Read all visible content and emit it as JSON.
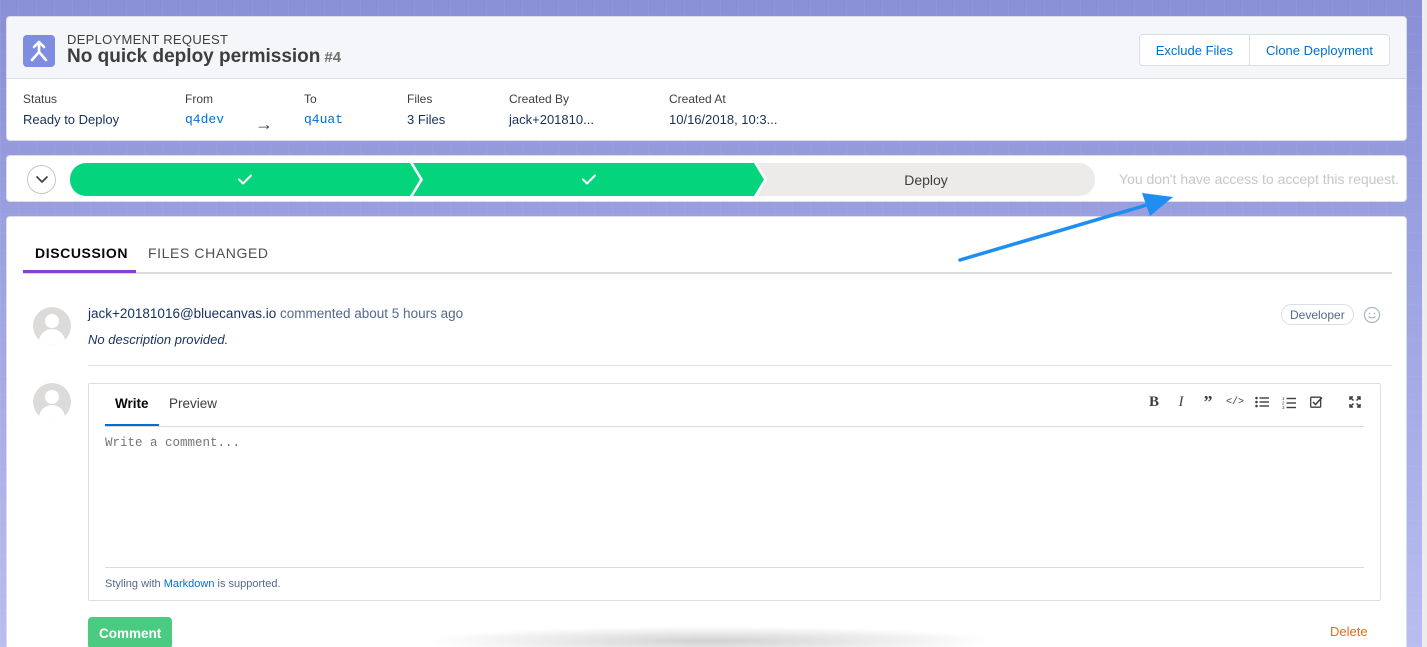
{
  "header": {
    "eyebrow": "DEPLOYMENT REQUEST",
    "title": "No quick deploy permission",
    "number": "#4",
    "icon": "merge-arrow-icon",
    "actions": {
      "exclude_files": "Exclude Files",
      "clone_deployment": "Clone Deployment"
    },
    "fields": {
      "status_label": "Status",
      "status_value": "Ready to Deploy",
      "from_label": "From",
      "from_value": "q4dev",
      "to_label": "To",
      "to_value": "q4uat",
      "files_label": "Files",
      "files_value": "3 Files",
      "created_by_label": "Created By",
      "created_by_value": "jack+201810...",
      "created_at_label": "Created At",
      "created_at_value": "10/16/2018, 10:3..."
    }
  },
  "path": {
    "stages": [
      {
        "status": "complete",
        "icon": "check-icon"
      },
      {
        "status": "complete",
        "icon": "check-icon"
      },
      {
        "status": "current",
        "label": "Deploy"
      }
    ],
    "message": "You don't have access to accept this request."
  },
  "tabs": [
    {
      "label": "DISCUSSION",
      "active": true
    },
    {
      "label": "FILES CHANGED",
      "active": false
    }
  ],
  "comment": {
    "author": "jack+20181016@bluecanvas.io",
    "action": "commented about 5 hours ago",
    "body": "No description provided.",
    "role": "Developer"
  },
  "editor": {
    "tabs": {
      "write": "Write",
      "preview": "Preview"
    },
    "placeholder": "Write a comment...",
    "footer_prefix": "Styling with",
    "footer_link": "Markdown",
    "footer_suffix": "is supported.",
    "toolbar": [
      "bold-icon",
      "italic-icon",
      "quote-icon",
      "code-icon",
      "bullet-list-icon",
      "numbered-list-icon",
      "task-list-icon",
      "fullscreen-icon"
    ]
  },
  "actions": {
    "comment": "Comment",
    "delete": "Delete"
  },
  "colors": {
    "path_complete": "#04d57d",
    "link": "#0070d2",
    "tab_active_underline": "#8b3fd1",
    "comment_button": "#4bca81",
    "delete": "#e96a0f",
    "annotation_arrow": "#1f8ef1"
  }
}
